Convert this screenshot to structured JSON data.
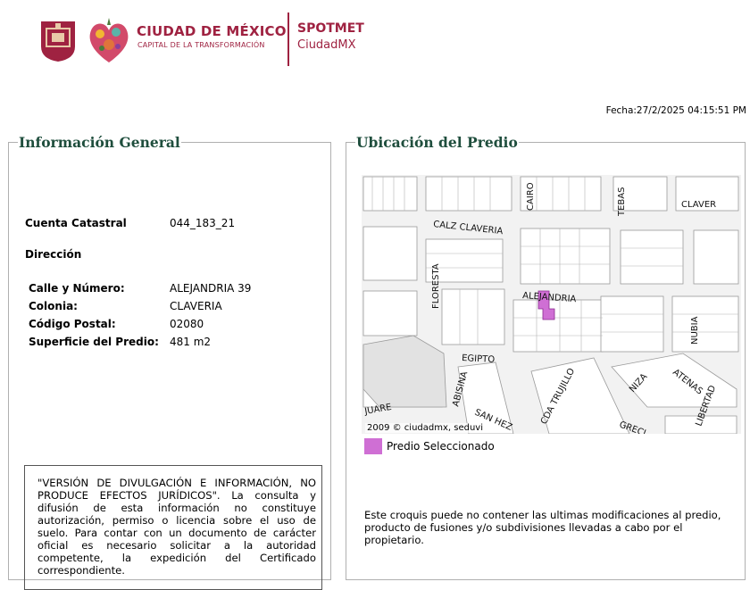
{
  "header": {
    "brand_title": "CIUDAD DE MÉXICO",
    "brand_subtitle": "CAPITAL DE LA TRANSFORMACIÓN",
    "app_name": "SPOTMET",
    "app_sub": "CiudadMX",
    "brand_color": "#9f2241"
  },
  "fecha": "Fecha:27/2/2025 04:15:51 PM",
  "info": {
    "legend": "Información General",
    "cuenta_label": "Cuenta Catastral",
    "cuenta_value": "044_183_21",
    "direccion_label": "Dirección",
    "calle_label": "Calle y Número:",
    "calle_value": "ALEJANDRIA 39",
    "colonia_label": "Colonia:",
    "colonia_value": "CLAVERIA",
    "cp_label": "Código Postal:",
    "cp_value": "02080",
    "superficie_label": "Superficie del Predio:",
    "superficie_value": "481 m2",
    "disclaimer": "\"VERSIÓN DE DIVULGACIÓN E INFORMACIÓN, NO PRODUCE EFECTOS JURÍDICOS\". La consulta y difusión de esta información no constituye autorización, permiso o licencia sobre el uso de suelo. Para contar con un documento de carácter oficial es necesario solicitar a la autoridad competente, la expedición del Certificado correspondiente."
  },
  "map": {
    "legend": "Ubicación del Predio",
    "streets": [
      "CAIRO",
      "TEBAS",
      "CLAVER",
      "CALZ CLAVERIA",
      "FLORESTA",
      "ALEJANDRIA",
      "NUBIA",
      "EGIPTO",
      "ABISINA",
      "CDA TRUJILLO",
      "NIZA",
      "ATENAS",
      "LIBERTAD",
      "JUARE",
      "SAN HEZ",
      "GRECI"
    ],
    "copyright": "2009 © ciudadmx, seduvi",
    "legend_label": "Predio Seleccionado",
    "selected_color": "#cf6fd4",
    "note": "Este croquis puede no contener las ultimas modificaciones al predio, producto de fusiones y/o subdivisiones llevadas a cabo por el propietario."
  }
}
